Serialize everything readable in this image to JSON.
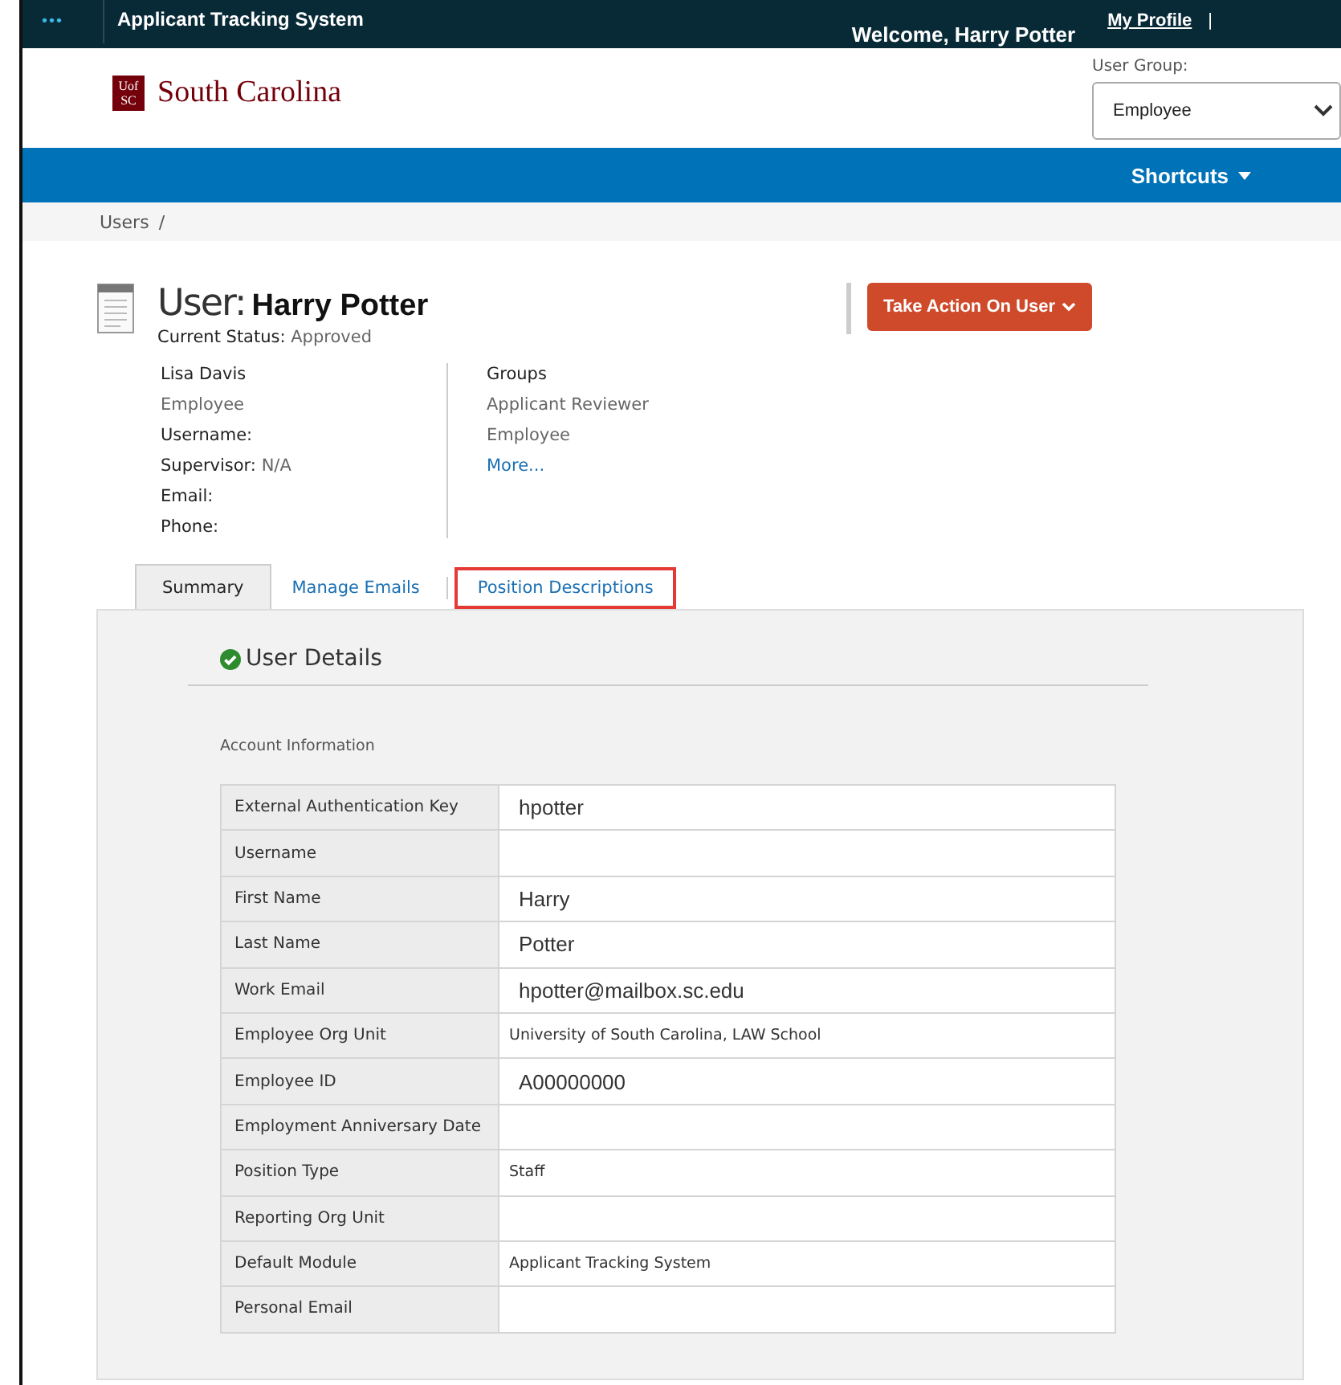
{
  "top_bar": {
    "menu_glyph": "•••",
    "app_name": "Applicant Tracking System",
    "welcome": "Welcome, Harry Potter",
    "profile_link": "My Profile",
    "separator": "|"
  },
  "header": {
    "logo_mark": [
      "Uof",
      "SC"
    ],
    "logo_text": "South Carolina",
    "user_group_label": "User Group:",
    "user_group_value": "Employee"
  },
  "nav": {
    "shortcuts": "Shortcuts"
  },
  "breadcrumb": [
    "Users",
    "/"
  ],
  "user": {
    "title_label": "User:",
    "name": "Harry Potter",
    "status_label": "Current Status:",
    "status_value": "Approved",
    "action_button": "Take Action On User"
  },
  "details_left": [
    {
      "kind": "heading",
      "text": "Lisa Davis"
    },
    {
      "kind": "plain",
      "text": "Employee"
    },
    {
      "kind": "field",
      "label": "Username:"
    },
    {
      "kind": "field",
      "label": "Supervisor:",
      "value": "N/A"
    },
    {
      "kind": "field",
      "label": "Email:"
    },
    {
      "kind": "field",
      "label": "Phone:"
    }
  ],
  "groups": {
    "heading": "Groups",
    "items": [
      "Applicant Reviewer",
      "Employee"
    ],
    "more_link": "More..."
  },
  "tabs": [
    {
      "label": "Summary",
      "selected": true,
      "highlighted": false
    },
    {
      "label": "Manage Emails",
      "selected": false,
      "highlighted": false
    },
    {
      "label": "Position Descriptions",
      "selected": false,
      "highlighted": true
    }
  ],
  "section": {
    "title": "User Details",
    "subtitle": "Account Information"
  },
  "rows": [
    {
      "label": "External Authentication Key",
      "value": "hpotter",
      "kind": "entered"
    },
    {
      "label": "Username"
    },
    {
      "label": "First Name",
      "value": "Harry",
      "kind": "entered"
    },
    {
      "label": "Last Name",
      "value": "Potter",
      "kind": "entered"
    },
    {
      "label": "Work Email",
      "value": "hpotter@mailbox.sc.edu",
      "kind": "entered"
    },
    {
      "label": "Employee Org Unit",
      "value": "University of South Carolina, LAW School",
      "kind": "system"
    },
    {
      "label": "Employee ID",
      "value": "A00000000",
      "kind": "entered"
    },
    {
      "label": "Employment Anniversary Date"
    },
    {
      "label": "Position Type",
      "value": "Staff",
      "kind": "system"
    },
    {
      "label": "Reporting Org Unit"
    },
    {
      "label": "Default Module",
      "value": "Applicant Tracking System",
      "kind": "system"
    },
    {
      "label": "Personal Email"
    }
  ]
}
